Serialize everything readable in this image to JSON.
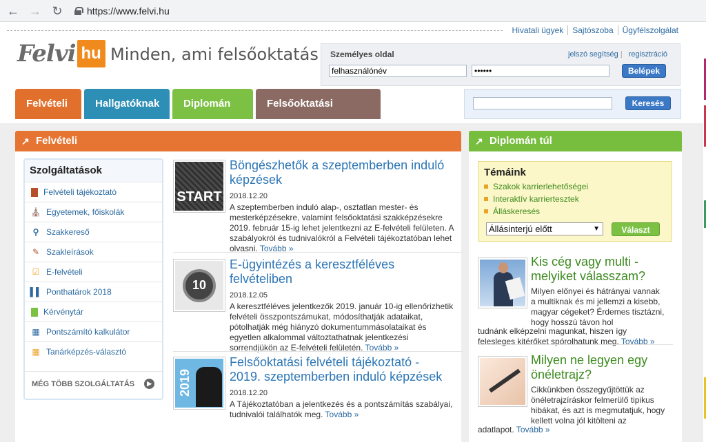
{
  "browser": {
    "url": "https://www.felvi.hu"
  },
  "toplinks": [
    "Hivatali ügyek",
    "Sajtószoba",
    "Ügyfélszolgálat"
  ],
  "logo": {
    "part1": "Felvi",
    "part2": "hu"
  },
  "tagline": "Minden, ami felsőoktatás",
  "login": {
    "title": "Személyes oldal",
    "help": "jelszó segítség",
    "register": "regisztráció",
    "username": "felhasználónév",
    "password": "••••••",
    "button": "Belépek"
  },
  "tabs": [
    "Felvételi",
    "Hallgatóknak",
    "Diplomán túl",
    "Felsőoktatási műhely"
  ],
  "search": {
    "button": "Keresés",
    "value": ""
  },
  "left_section": {
    "title": "Felvételi"
  },
  "services": {
    "title": "Szolgáltatások",
    "items": [
      {
        "label": "Felvételi tájékoztató",
        "icon": "book-icon"
      },
      {
        "label": "Egyetemek, főiskolák",
        "icon": "building-icon"
      },
      {
        "label": "Szakkereső",
        "icon": "magnifier-icon"
      },
      {
        "label": "Szakleírások",
        "icon": "document-icon"
      },
      {
        "label": "E-felvételi",
        "icon": "checkbox-icon"
      },
      {
        "label": "Ponthatárok 2018",
        "icon": "bar-chart-icon"
      },
      {
        "label": "Kérvénytár",
        "icon": "file-icon"
      },
      {
        "label": "Pontszámító kalkulátor",
        "icon": "calculator-icon"
      },
      {
        "label": "Tanárképzés-választó",
        "icon": "table-icon"
      }
    ],
    "more": "MÉG TÖBB SZOLGÁLTATÁS"
  },
  "articles": [
    {
      "title": "Böngészhetők a szeptemberben induló képzések",
      "date": "2018.12.20",
      "text": "A szeptemberben induló alap-, osztatlan mester- és mesterképzésekre, valamint felsőoktatási szakképzésekre 2019. február 15-ig lehet jelentkezni az E-felvételi felületen. A szabályokról és tudnivalókról a Felvételi tájékoztatóban lehet olvasni.",
      "more": "Tovább »",
      "thumb_text": "START"
    },
    {
      "title": "E-ügyintézés a keresztféléves felvételiben",
      "date": "2018.12.05",
      "text": "A keresztféléves jelentkezők 2019. január 10-ig ellenőrizhetik felvételi összpontszámukat, módosíthatják adataikat, pótolhatják még hiányzó dokumentummásolataikat és egyetlen alkalommal változtathatnak jelentkezési sorrendjükön az E-felvételi felületén.",
      "more": "Tovább »",
      "thumb_text": "10"
    },
    {
      "title": "Felsőoktatási felvételi tájékoztató - 2019. szeptemberben induló képzések",
      "date": "2018.12.20",
      "text": "A Tájékoztatóban a jelentkezés és a pontszámítás szabályai, tudnivalói találhatók meg.",
      "more": "Tovább »",
      "thumb_text": "2019"
    }
  ],
  "right_section": {
    "title": "Diplomán túl"
  },
  "topics": {
    "title": "Témáink",
    "items": [
      "Szakok karrierlehetőségei",
      "Interaktív karriertesztek",
      "Álláskeresés"
    ],
    "select": "Állásinterjú előtt",
    "button": "Választ"
  },
  "right_articles": [
    {
      "title": "Kis cég vagy multi - melyiket válasszam?",
      "text_short": "Milyen előnyei és hátrányai vannak a multiknak és mi jellemzi a kisebb, magyar cégeket? Érdemes tisztázni, hogy hosszú távon hol",
      "text_full": "tudnánk elképzelni magunkat, hiszen így felesleges kitérőket spórolhatunk meg.",
      "more": "Tovább »"
    },
    {
      "title": "Milyen ne legyen egy önéletrajz?",
      "text_short": "Cikkünkben összegyűjtöttük az önéletrajzíráskor felmerülő tipikus hibákat, és azt is megmutatjuk, hogy kellett volna jól kitölteni az",
      "text_full": "adatlapot.",
      "more": "Tovább »"
    }
  ],
  "colors": {
    "orange": "#e67533",
    "blue": "#2d8fb6",
    "green": "#77bd3e",
    "brown": "#8a6a62",
    "link": "#2c6aa0"
  }
}
